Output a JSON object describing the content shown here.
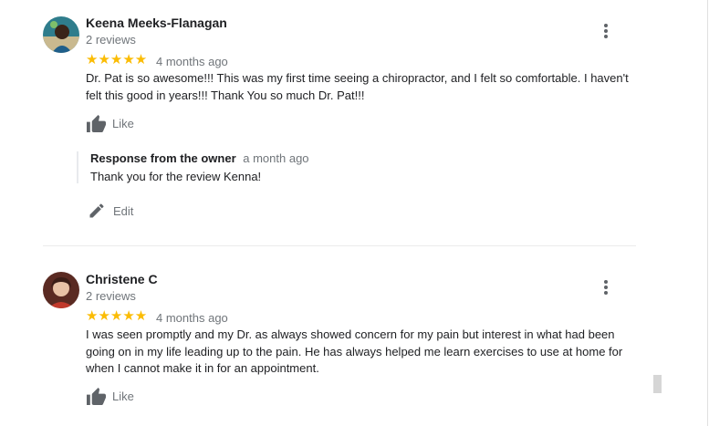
{
  "reviews": [
    {
      "reviewer": "Keena Meeks-Flanagan",
      "review_count": "2 reviews",
      "stars": "★★★★★",
      "rating": 5,
      "time": "4 months ago",
      "text": "Dr. Pat is so awesome!!! This was my first time seeing a chiropractor, and I felt so comfortable. I haven't felt this good in years!!! Thank You so much Dr. Pat!!!",
      "like_label": "Like",
      "response": {
        "title": "Response from the owner",
        "time": "a month ago",
        "text": "Thank you for the review Kenna!"
      },
      "edit_label": "Edit"
    },
    {
      "reviewer": "Christene C",
      "review_count": "2 reviews",
      "stars": "★★★★★",
      "rating": 5,
      "time": "4 months ago",
      "text": "I was seen promptly and my Dr. as always showed concern for my pain but interest in what had been going on in my life leading up to the pain. He has always helped me learn exercises to use at home for when I cannot make it in for an appointment.",
      "like_label": "Like"
    }
  ],
  "icons": {
    "menu": "more-vert-icon",
    "like": "thumb-up-icon",
    "edit": "pencil-icon"
  },
  "colors": {
    "star": "#fbbc04",
    "secondary_text": "#70757a",
    "icon": "#5f6368"
  }
}
